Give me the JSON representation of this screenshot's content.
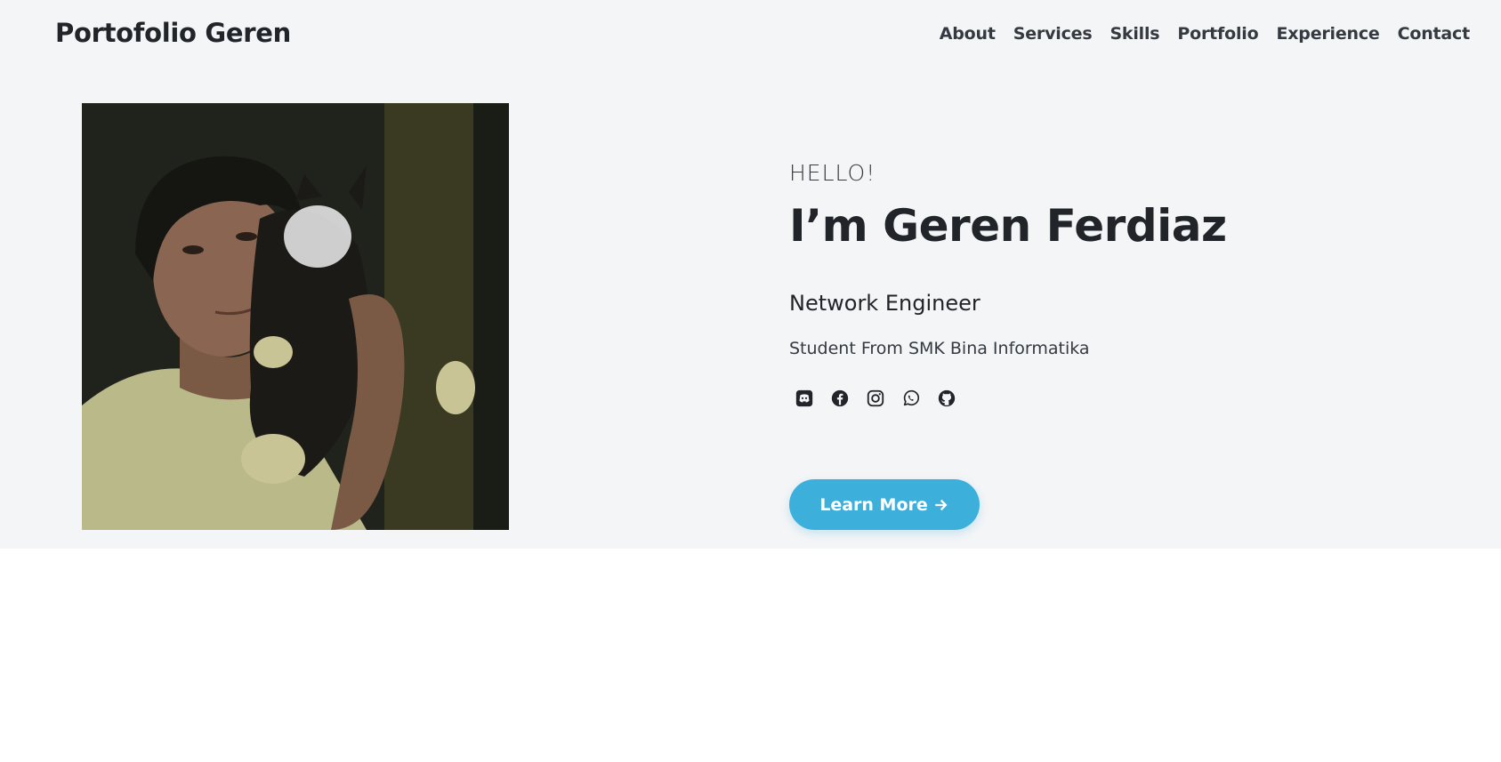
{
  "navbar": {
    "brand": "Portofolio Geren",
    "links": [
      {
        "label": "About"
      },
      {
        "label": "Services"
      },
      {
        "label": "Skills"
      },
      {
        "label": "Portfolio"
      },
      {
        "label": "Experience"
      },
      {
        "label": "Contact"
      }
    ]
  },
  "hero": {
    "photo_alt": "profile-photo",
    "greeting": "HELLO!",
    "name": "I’m Geren Ferdiaz",
    "role": "Network Engineer",
    "school": "Student From SMK Bina Informatika",
    "socials": [
      {
        "icon": "discord-icon"
      },
      {
        "icon": "facebook-icon"
      },
      {
        "icon": "instagram-icon"
      },
      {
        "icon": "whatsapp-icon"
      },
      {
        "icon": "github-icon"
      }
    ],
    "cta_label": "Learn More",
    "cta_icon": "arrow-right-icon"
  },
  "colors": {
    "hero_background": "#f4f5f7",
    "accent": "#3cb0da",
    "text": "#212529"
  }
}
